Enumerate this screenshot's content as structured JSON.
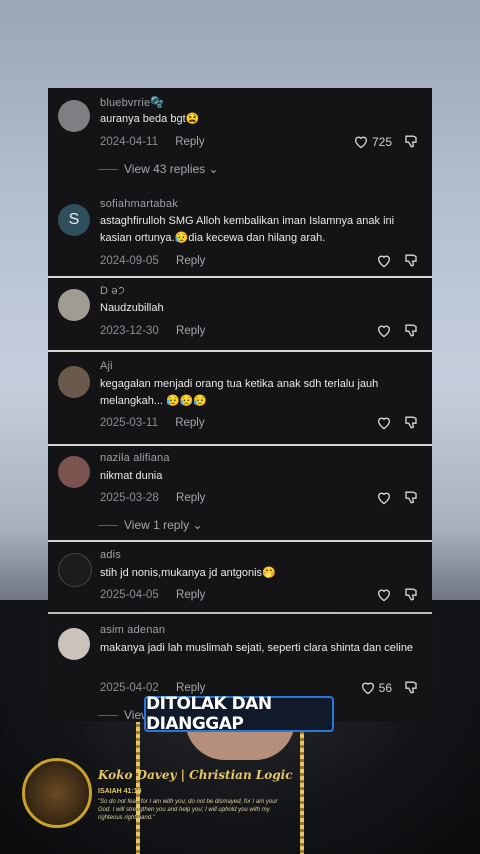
{
  "comments": [
    {
      "user": "bluebvrrie🫧",
      "text": "auranya beda bgt😫",
      "date": "2024-04-11",
      "reply": "Reply",
      "likes": "725",
      "view_replies": "View 43 replies ⌄"
    },
    {
      "user": "sofiahmartabak",
      "avatar_letter": "S",
      "text": "astaghfirulloh SMG Alloh kembalikan iman Islamnya anak ini kasian ortunya.😥dia kecewa dan hilang arah.",
      "date": "2024-09-05",
      "reply": "Reply"
    },
    {
      "user": "D ə੭",
      "text": "Naudzubillah",
      "date": "2023-12-30",
      "reply": "Reply"
    },
    {
      "user": "Aji",
      "text": "kegagalan menjadi orang tua ketika anak sdh terlalu jauh melangkah... 😥😥😥",
      "date": "2025-03-11",
      "reply": "Reply"
    },
    {
      "user": "nazila alifiana",
      "text": "nikmat dunia",
      "date": "2025-03-28",
      "reply": "Reply",
      "view_replies": "View 1 reply ⌄"
    },
    {
      "user": "adis",
      "text": "stih jd nonis,mukanya jd antgonis🤭",
      "date": "2025-04-05",
      "reply": "Reply"
    },
    {
      "user": "asim adenan",
      "text": "makanya jadi lah muslimah sejati, seperti clara shinta dan celine",
      "date": "2025-04-02",
      "reply": "Reply",
      "likes": "56",
      "view_replies": "View"
    }
  ],
  "caption": "DITOLAK DAN DIANGGAP",
  "channel": {
    "name": "Koko Davey | Christian Logic",
    "reference": "ISAIAH 41:10",
    "verse": "\"So do not fear, for I am with you; do not be dismayed, for I am your God. I will strengthen you and help you; I will uphold you with my righteous right hand.\""
  },
  "colors": {
    "panel": "#141416",
    "caption_border": "#2b77d9",
    "gold": "#e8c66a"
  }
}
